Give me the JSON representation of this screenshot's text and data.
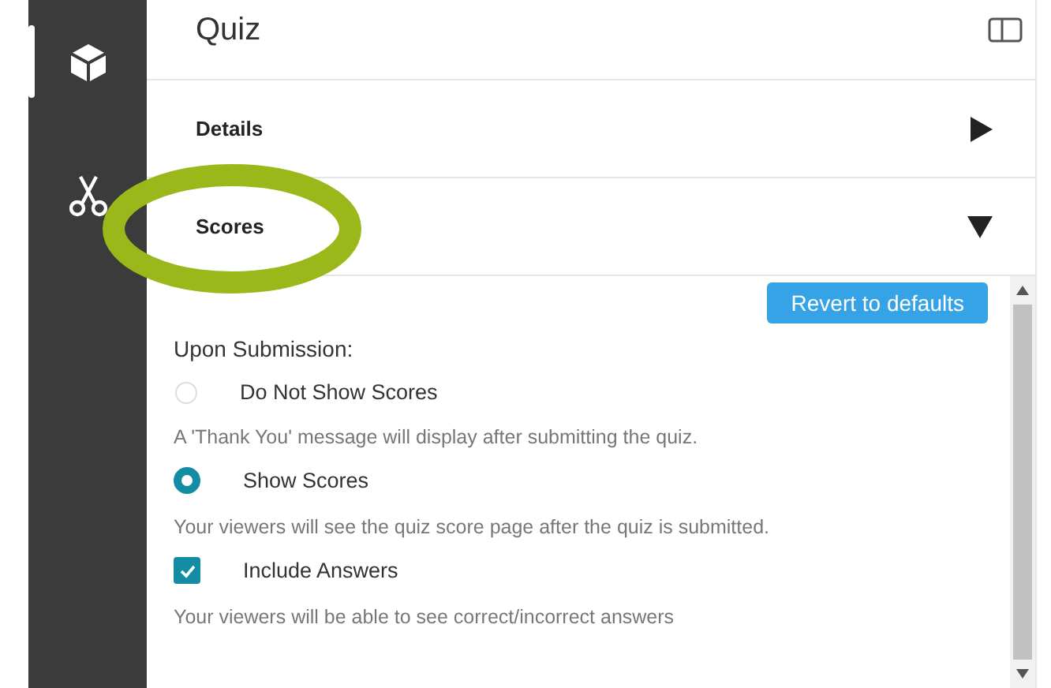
{
  "sidebar": {
    "items": [
      {
        "kind": "cube",
        "selected": true
      },
      {
        "kind": "scissors",
        "selected": false
      }
    ]
  },
  "header": {
    "title": "Quiz"
  },
  "sections": [
    {
      "title": "Details",
      "expanded": false
    },
    {
      "title": "Scores",
      "expanded": true
    }
  ],
  "scores_panel": {
    "revert_button": "Revert to defaults",
    "heading": "Upon Submission:",
    "options": [
      {
        "kind": "radio",
        "label": "Do Not Show Scores",
        "selected": false,
        "description": "A 'Thank You' message will display after submitting the quiz."
      },
      {
        "kind": "radio",
        "label": "Show Scores",
        "selected": true,
        "description": "Your viewers will see the quiz score page after the quiz is submitted."
      },
      {
        "kind": "checkbox",
        "label": "Include Answers",
        "checked": true,
        "description": "Your viewers will be able to see correct/incorrect answers"
      }
    ]
  }
}
